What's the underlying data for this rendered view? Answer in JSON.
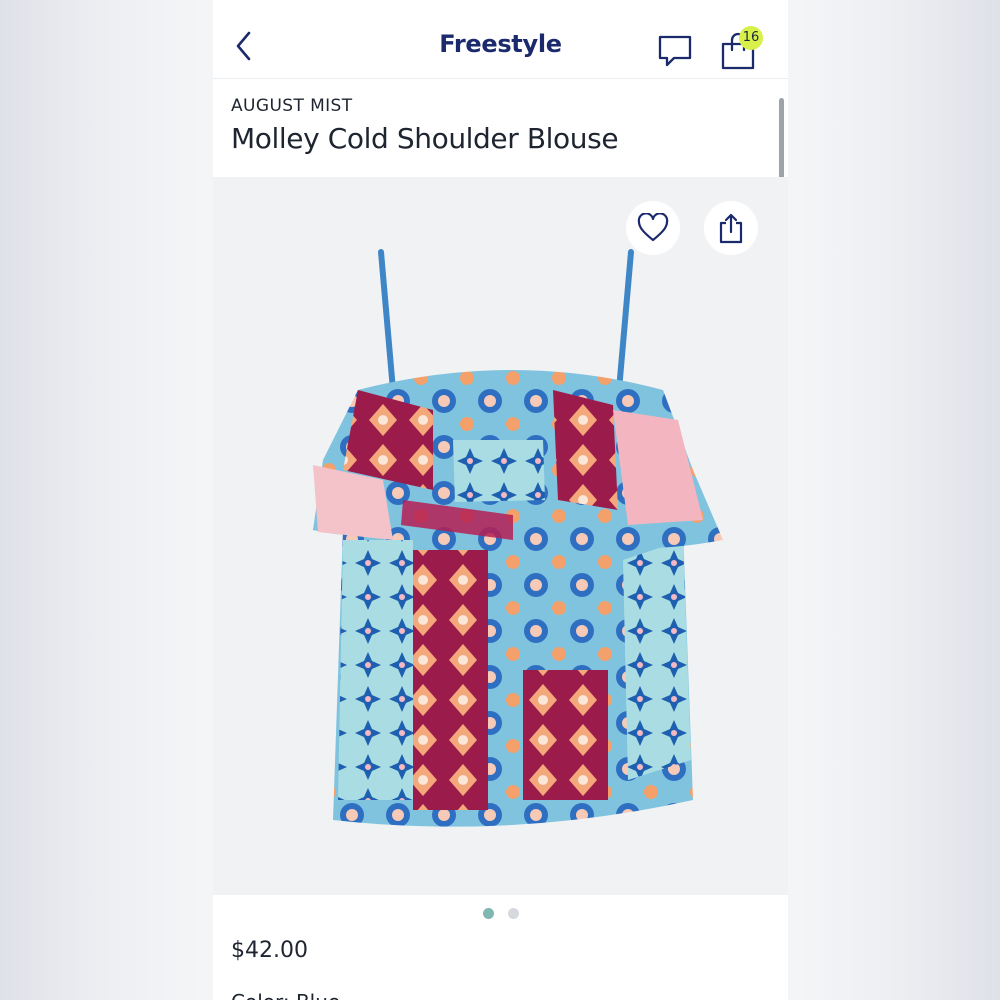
{
  "header": {
    "title": "Freestyle",
    "back_icon": "chevron-left-icon",
    "chat_icon": "chat-bubble-icon",
    "bag_icon": "shopping-bag-icon",
    "bag_count": "16"
  },
  "product": {
    "brand": "AUGUST MIST",
    "name": "Molley Cold Shoulder Blouse",
    "price": "$42.00",
    "color_label": "Color: Blue"
  },
  "gallery": {
    "total_images": 2,
    "current_index": 1,
    "favorite_icon": "heart-outline-icon",
    "share_icon": "share-icon"
  },
  "colors": {
    "brand_navy": "#1a2a6c",
    "badge_lime": "#d8f049",
    "dot_active": "#7fb8b0",
    "dot_inactive": "#d5d8dc",
    "text_dark": "#1f2530"
  }
}
